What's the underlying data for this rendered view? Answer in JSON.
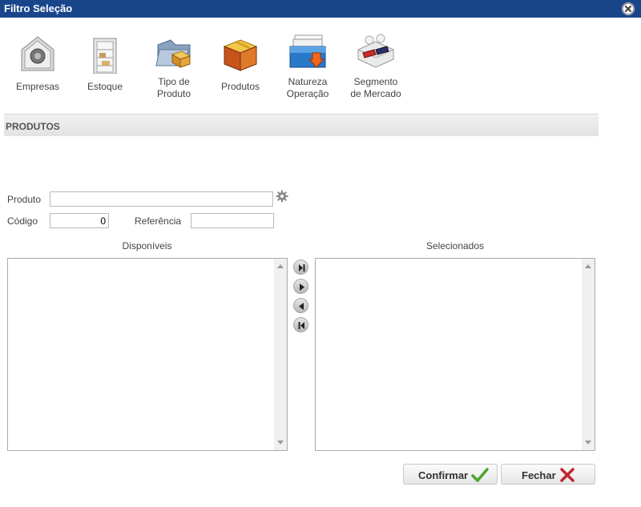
{
  "window": {
    "title": "Filtro Seleção",
    "close_icon": "close-icon"
  },
  "toolbar": [
    {
      "label": "Empresas",
      "icon": "safe-icon"
    },
    {
      "label": "Estoque",
      "icon": "shelf-icon"
    },
    {
      "label": "Tipo de\nProduto",
      "icon": "product-type-icon"
    },
    {
      "label": "Produtos",
      "icon": "box-icon"
    },
    {
      "label": "Natureza\nOperação",
      "icon": "operation-nature-icon"
    },
    {
      "label": "Segmento\nde Mercado",
      "icon": "market-segment-icon"
    }
  ],
  "section": {
    "title": "PRODUTOS"
  },
  "form": {
    "produto_label": "Produto",
    "produto_value": "",
    "codigo_label": "Código",
    "codigo_value": "0",
    "referencia_label": "Referência",
    "referencia_value": ""
  },
  "lists": {
    "available_title": "Disponíveis",
    "selected_title": "Selecionados"
  },
  "buttons": {
    "confirm": "Confirmar",
    "close": "Fechar"
  },
  "colors": {
    "title_bar": "#19458b",
    "confirm_icon": "#4aa52e",
    "close_icon": "#c0272d"
  }
}
